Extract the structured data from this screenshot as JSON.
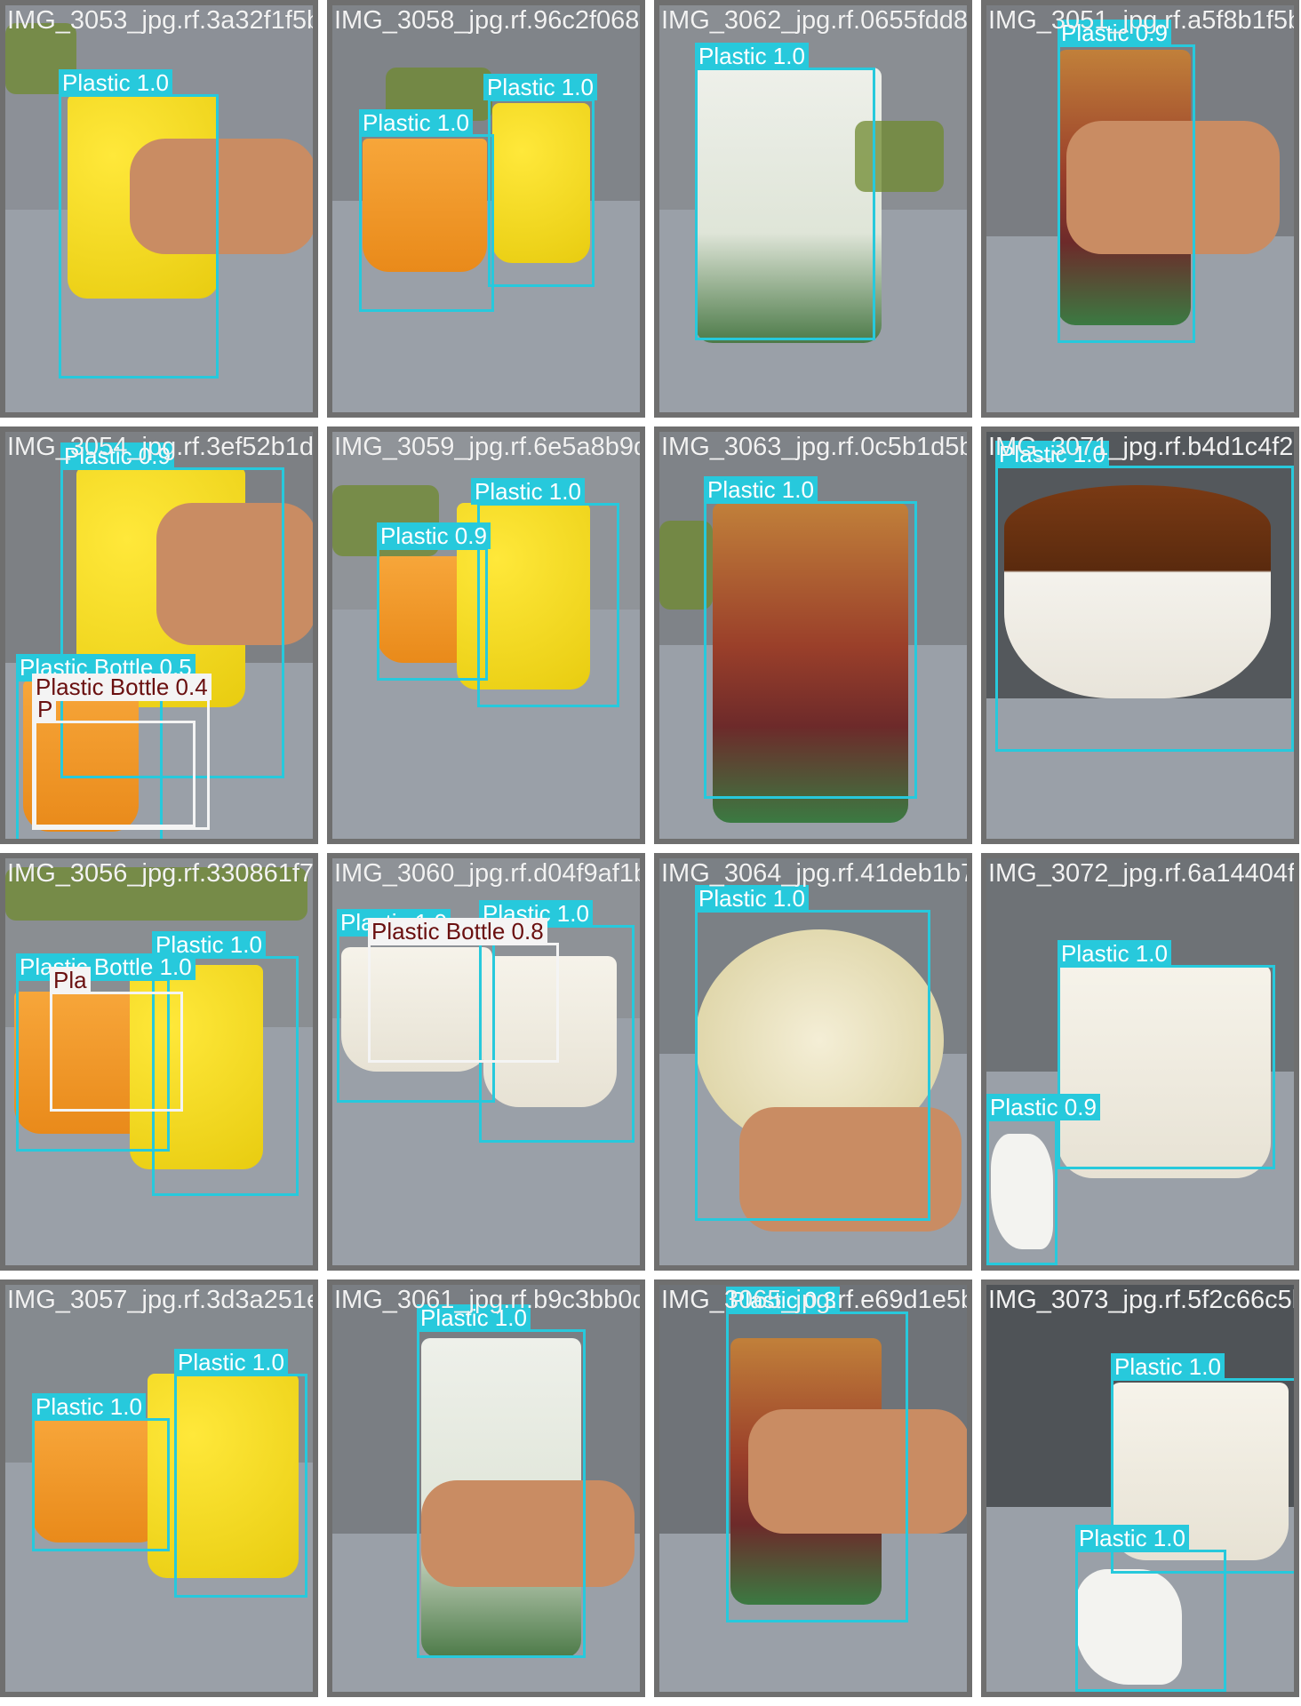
{
  "colors": {
    "plastic": "#27c9dc",
    "plastic_bottle": "#f4f4f4",
    "tile_border": "#6f6f6f"
  },
  "tiles": [
    {
      "filename": "IMG_3053_jpg.rf.3a32f1f5b748f3f6580e5f2068ab7a8b5bf6c8d5fd06516d8098ca51b5f97f1c",
      "detections": [
        {
          "label": "Plastic 1.0"
        }
      ]
    },
    {
      "filename": "IMG_3058_jpg.rf.96c2f068ab7a8b37685f6a1c065f1dd809b83a5f8",
      "detections": [
        {
          "label": "Plastic 1.0"
        },
        {
          "label": "Plastic 1.0"
        }
      ]
    },
    {
      "filename": "IMG_3062_jpg.rf.0655fdd809b61a",
      "detections": [
        {
          "label": "Plastic 1.0"
        }
      ]
    },
    {
      "filename": "IMG_3051_jpg.rf.a5f8b1f5b7e",
      "detections": [
        {
          "label": "Plastic 0.9"
        }
      ]
    },
    {
      "filename": "IMG_3054_jpg.rf.3ef52b1d4a63e8b0bc0f6b8e3f64d160e47c1827jpg.rf.b0b4b650",
      "detections": [
        {
          "label": "Plastic 0.9"
        },
        {
          "label": "Plastic Bottle 0.5"
        },
        {
          "label": "Plastic Bottle 0.4"
        },
        {
          "label": "P"
        }
      ]
    },
    {
      "filename": "IMG_3059_jpg.rf.6e5a8b9db0f0e7e1c6d",
      "detections": [
        {
          "label": "Plastic 1.0"
        },
        {
          "label": "Plastic 0.9"
        }
      ]
    },
    {
      "filename": "IMG_3063_jpg.rf.0c5b1d5b1d0",
      "detections": [
        {
          "label": "Plastic 1.0"
        }
      ]
    },
    {
      "filename": "IMG_3071_jpg.rf.b4d1c4f2650",
      "detections": [
        {
          "label": "Plastic 1.0"
        }
      ]
    },
    {
      "filename": "IMG_3056_jpg.rf.330861f7b5e9dd204f3f5f2d94f9af1b32e699a4f1deb1b77b6a14404f4f05f60f8",
      "detections": [
        {
          "label": "Plastic 1.0"
        },
        {
          "label": "Plastic Bottle 1.0"
        },
        {
          "label": "Pla"
        }
      ]
    },
    {
      "filename": "IMG_3060_jpg.rf.d04f9af1b32",
      "detections": [
        {
          "label": "Plastic 1.0"
        },
        {
          "label": "Plastic 1.0"
        },
        {
          "label": "Plastic Bottle 0.8"
        }
      ]
    },
    {
      "filename": "IMG_3064_jpg.rf.41deb1b7",
      "detections": [
        {
          "label": "Plastic 1.0"
        }
      ]
    },
    {
      "filename": "IMG_3072_jpg.rf.6a14404f4f05f760f8",
      "detections": [
        {
          "label": "Plastic 1.0"
        },
        {
          "label": "Plastic 0.9"
        }
      ]
    },
    {
      "filename": "IMG_3057_jpg.rf.3d3a251e8b9c3bb0de7e69d1e5b61113e5f2c66c5b7e",
      "detections": [
        {
          "label": "Plastic 1.0"
        },
        {
          "label": "Plastic 1.0"
        }
      ]
    },
    {
      "filename": "IMG_3061_jpg.rf.b9c3bb0de7e",
      "detections": [
        {
          "label": "Plastic 1.0"
        }
      ]
    },
    {
      "filename": "IMG_3065_jpg.rf.e69d1e5b61113",
      "detections": [
        {
          "label": "Plastic 0.3"
        }
      ]
    },
    {
      "filename": "IMG_3073_jpg.rf.5f2c66c5b7e",
      "detections": [
        {
          "label": "Plastic 1.0"
        },
        {
          "label": "Plastic 1.0"
        }
      ]
    }
  ]
}
